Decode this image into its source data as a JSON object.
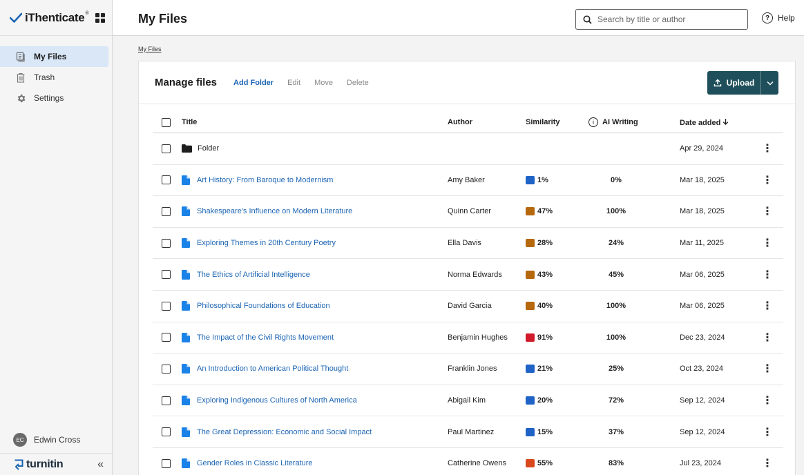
{
  "app": {
    "logo_text": "iThenticate",
    "brand_text": "turnitin",
    "page_title": "My Files",
    "breadcrumb": "My Files",
    "help_label": "Help",
    "search_placeholder": "Search by title or author"
  },
  "sidebar": {
    "items": [
      {
        "label": "My Files",
        "icon": "my-files-icon",
        "active": true
      },
      {
        "label": "Trash",
        "icon": "trash-icon",
        "active": false
      },
      {
        "label": "Settings",
        "icon": "gear-icon",
        "active": false
      }
    ],
    "user": {
      "initials": "EC",
      "name": "Edwin Cross"
    }
  },
  "manage": {
    "title": "Manage files",
    "actions": [
      {
        "label": "Add Folder",
        "enabled": true
      },
      {
        "label": "Edit",
        "enabled": false
      },
      {
        "label": "Move",
        "enabled": false
      },
      {
        "label": "Delete",
        "enabled": false
      }
    ],
    "upload_label": "Upload"
  },
  "table": {
    "headers": {
      "title": "Title",
      "author": "Author",
      "similarity": "Similarity",
      "ai_writing": "AI Writing",
      "date_added": "Date added"
    },
    "rows": [
      {
        "type": "folder",
        "title": "Folder",
        "author": "",
        "similarity": "",
        "sim_color": "",
        "ai": "",
        "date": "Apr 29, 2024"
      },
      {
        "type": "file",
        "title": "Art History: From Baroque to Modernism",
        "author": "Amy Baker",
        "similarity": "1%",
        "sim_color": "#1f63c6",
        "ai": "0%",
        "date": "Mar 18, 2025"
      },
      {
        "type": "file",
        "title": "Shakespeare's Influence on Modern Literature",
        "author": "Quinn Carter",
        "similarity": "47%",
        "sim_color": "#b5680c",
        "ai": "100%",
        "date": "Mar 18, 2025"
      },
      {
        "type": "file",
        "title": "Exploring Themes in 20th Century Poetry",
        "author": "Ella Davis",
        "similarity": "28%",
        "sim_color": "#b5680c",
        "ai": "24%",
        "date": "Mar 11, 2025"
      },
      {
        "type": "file",
        "title": "The Ethics of Artificial Intelligence",
        "author": "Norma Edwards",
        "similarity": "43%",
        "sim_color": "#b5680c",
        "ai": "45%",
        "date": "Mar 06, 2025"
      },
      {
        "type": "file",
        "title": "Philosophical Foundations of Education",
        "author": "David Garcia",
        "similarity": "40%",
        "sim_color": "#b5680c",
        "ai": "100%",
        "date": "Mar 06, 2025"
      },
      {
        "type": "file",
        "title": "The Impact of the Civil Rights Movement",
        "author": "Benjamin Hughes",
        "similarity": "91%",
        "sim_color": "#d11a2a",
        "ai": "100%",
        "date": "Dec 23, 2024"
      },
      {
        "type": "file",
        "title": "An Introduction to American Political Thought",
        "author": "Franklin Jones",
        "similarity": "21%",
        "sim_color": "#1f63c6",
        "ai": "25%",
        "date": "Oct 23, 2024"
      },
      {
        "type": "file",
        "title": "Exploring Indigenous Cultures of North America",
        "author": "Abigail Kim",
        "similarity": "20%",
        "sim_color": "#1f63c6",
        "ai": "72%",
        "date": "Sep 12, 2024"
      },
      {
        "type": "file",
        "title": "The Great Depression: Economic and Social Impact",
        "author": "Paul Martinez",
        "similarity": "15%",
        "sim_color": "#1f63c6",
        "ai": "37%",
        "date": "Sep 12, 2024"
      },
      {
        "type": "file",
        "title": "Gender Roles in Classic Literature",
        "author": "Catherine Owens",
        "similarity": "55%",
        "sim_color": "#d9481c",
        "ai": "83%",
        "date": "Jul 23, 2024"
      }
    ]
  },
  "colors": {
    "accent": "#1b64b3",
    "upload_bg": "#1f4f5a",
    "active_nav": "#d9e7f7"
  }
}
